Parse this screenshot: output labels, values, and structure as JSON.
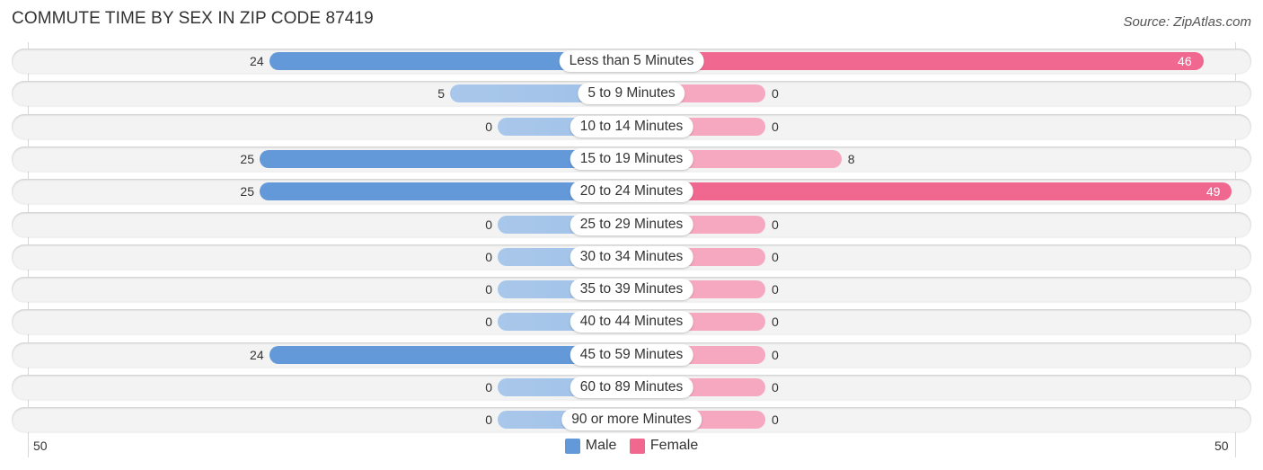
{
  "chart_data": {
    "type": "bar",
    "orientation": "horizontal-diverging",
    "title": "COMMUTE TIME BY SEX IN ZIP CODE 87419",
    "source": "Source: ZipAtlas.com",
    "categories": [
      "Less than 5 Minutes",
      "5 to 9 Minutes",
      "10 to 14 Minutes",
      "15 to 19 Minutes",
      "20 to 24 Minutes",
      "25 to 29 Minutes",
      "30 to 34 Minutes",
      "35 to 39 Minutes",
      "40 to 44 Minutes",
      "45 to 59 Minutes",
      "60 to 89 Minutes",
      "90 or more Minutes"
    ],
    "series": [
      {
        "name": "Male",
        "color": "#6399d8",
        "values": [
          24,
          5,
          0,
          25,
          25,
          0,
          0,
          0,
          0,
          24,
          0,
          0
        ]
      },
      {
        "name": "Female",
        "color": "#f06890",
        "values": [
          46,
          0,
          0,
          8,
          49,
          0,
          0,
          0,
          0,
          0,
          0,
          0
        ]
      }
    ],
    "axis": {
      "left_tick": "50",
      "right_tick": "50",
      "range": [
        -50,
        50
      ]
    },
    "legend": {
      "position": "bottom-center",
      "entries": [
        "Male",
        "Female"
      ]
    },
    "grid": false
  }
}
